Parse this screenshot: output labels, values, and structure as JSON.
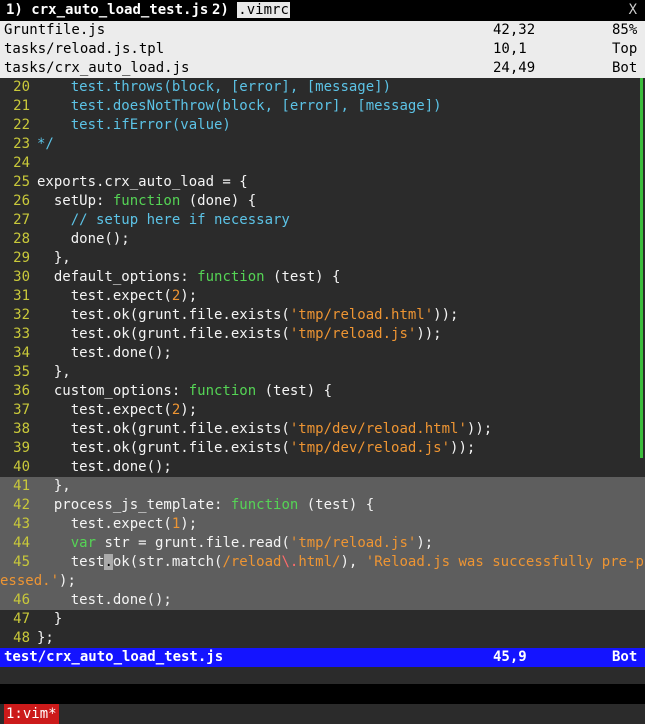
{
  "tabline": {
    "tab1_num": "1)",
    "tab1_name": "crx_auto_load_test.js",
    "tab2_num": "2)",
    "tab2_name": ".vimrc",
    "close": "X"
  },
  "buffers": [
    {
      "name": "Gruntfile.js",
      "pos": "42,32",
      "pct": "85%"
    },
    {
      "name": "tasks/reload.js.tpl",
      "pos": "10,1",
      "pct": "Top"
    },
    {
      "name": "tasks/crx_auto_load.js",
      "pos": "24,49",
      "pct": "Bot"
    }
  ],
  "code": [
    {
      "ln": "20",
      "segs": [
        [
          "    ",
          ""
        ],
        [
          "test.throws(block, [error], [message])",
          "c-fn"
        ]
      ]
    },
    {
      "ln": "21",
      "segs": [
        [
          "    ",
          ""
        ],
        [
          "test.doesNotThrow(block, [error], [message])",
          "c-fn"
        ]
      ]
    },
    {
      "ln": "22",
      "segs": [
        [
          "    ",
          ""
        ],
        [
          "test.ifError(value)",
          "c-fn"
        ]
      ]
    },
    {
      "ln": "23",
      "segs": [
        [
          "*/",
          "c-fn"
        ]
      ]
    },
    {
      "ln": "24",
      "segs": []
    },
    {
      "ln": "25",
      "segs": [
        [
          "exports.crx_auto_load = {",
          ""
        ]
      ]
    },
    {
      "ln": "26",
      "segs": [
        [
          "  setUp: ",
          ""
        ],
        [
          "function",
          "c-kw"
        ],
        [
          " (done) {",
          ""
        ]
      ]
    },
    {
      "ln": "27",
      "segs": [
        [
          "    ",
          ""
        ],
        [
          "// setup here if necessary",
          "c-fn"
        ]
      ]
    },
    {
      "ln": "28",
      "segs": [
        [
          "    done();",
          ""
        ]
      ]
    },
    {
      "ln": "29",
      "segs": [
        [
          "  },",
          ""
        ]
      ]
    },
    {
      "ln": "30",
      "segs": [
        [
          "  default_options: ",
          ""
        ],
        [
          "function",
          "c-kw"
        ],
        [
          " (test) {",
          ""
        ]
      ]
    },
    {
      "ln": "31",
      "segs": [
        [
          "    test.expect(",
          ""
        ],
        [
          "2",
          "c-num"
        ],
        [
          ");",
          ""
        ]
      ]
    },
    {
      "ln": "32",
      "segs": [
        [
          "    test.ok(grunt.file.exists(",
          ""
        ],
        [
          "'tmp/reload.html'",
          "c-str"
        ],
        [
          "));",
          ""
        ]
      ]
    },
    {
      "ln": "33",
      "segs": [
        [
          "    test.ok(grunt.file.exists(",
          ""
        ],
        [
          "'tmp/reload.js'",
          "c-str"
        ],
        [
          "));",
          ""
        ]
      ]
    },
    {
      "ln": "34",
      "segs": [
        [
          "    test.done();",
          ""
        ]
      ]
    },
    {
      "ln": "35",
      "segs": [
        [
          "  },",
          ""
        ]
      ]
    },
    {
      "ln": "36",
      "segs": [
        [
          "  custom_options: ",
          ""
        ],
        [
          "function",
          "c-kw"
        ],
        [
          " (test) {",
          ""
        ]
      ]
    },
    {
      "ln": "37",
      "segs": [
        [
          "    test.expect(",
          ""
        ],
        [
          "2",
          "c-num"
        ],
        [
          ");",
          ""
        ]
      ]
    },
    {
      "ln": "38",
      "segs": [
        [
          "    test.ok(grunt.file.exists(",
          ""
        ],
        [
          "'tmp/dev/reload.html'",
          "c-str"
        ],
        [
          "));",
          ""
        ]
      ]
    },
    {
      "ln": "39",
      "segs": [
        [
          "    test.ok(grunt.file.exists(",
          ""
        ],
        [
          "'tmp/dev/reload.js'",
          "c-str"
        ],
        [
          "));",
          ""
        ]
      ]
    },
    {
      "ln": "40",
      "segs": [
        [
          "    test.done();",
          ""
        ]
      ]
    },
    {
      "ln": "41",
      "segs": [
        [
          "  },",
          ""
        ]
      ],
      "sel": true
    },
    {
      "ln": "42",
      "segs": [
        [
          "  process_js_template: ",
          ""
        ],
        [
          "function",
          "c-kw"
        ],
        [
          " (test) {",
          ""
        ]
      ],
      "sel": true
    },
    {
      "ln": "43",
      "segs": [
        [
          "    test.expect(",
          ""
        ],
        [
          "1",
          "c-num"
        ],
        [
          ");",
          ""
        ]
      ],
      "sel": true
    },
    {
      "ln": "44",
      "segs": [
        [
          "    ",
          ""
        ],
        [
          "var",
          "c-kw"
        ],
        [
          " str = grunt.file.read(",
          ""
        ],
        [
          "'tmp/reload.js'",
          "c-str"
        ],
        [
          ");",
          ""
        ]
      ],
      "sel": true
    },
    {
      "ln": "45",
      "segs": [
        [
          "    test",
          ""
        ],
        [
          ".",
          "cursor"
        ],
        [
          "ok(str.match(",
          ""
        ],
        [
          "/reload",
          "c-str"
        ],
        [
          "\\.",
          "c-esc"
        ],
        [
          "html/",
          "c-str"
        ],
        [
          "), ",
          ""
        ],
        [
          "'Reload.js was successfully pre-proc",
          "c-str"
        ]
      ],
      "sel": true
    },
    {
      "ln": "",
      "segs": [
        [
          "essed.'",
          "c-str"
        ],
        [
          ");",
          ""
        ]
      ],
      "sel": true,
      "wrap": true
    },
    {
      "ln": "46",
      "segs": [
        [
          "    test.done();",
          ""
        ]
      ],
      "sel": true
    },
    {
      "ln": "47",
      "segs": [
        [
          "  }",
          ""
        ]
      ]
    },
    {
      "ln": "48",
      "segs": [
        [
          "};",
          ""
        ]
      ]
    }
  ],
  "status": {
    "file": "test/crx_auto_load_test.js",
    "pos": "45,9",
    "pct": "Bot"
  },
  "tmux": {
    "window": "1:vim*"
  }
}
